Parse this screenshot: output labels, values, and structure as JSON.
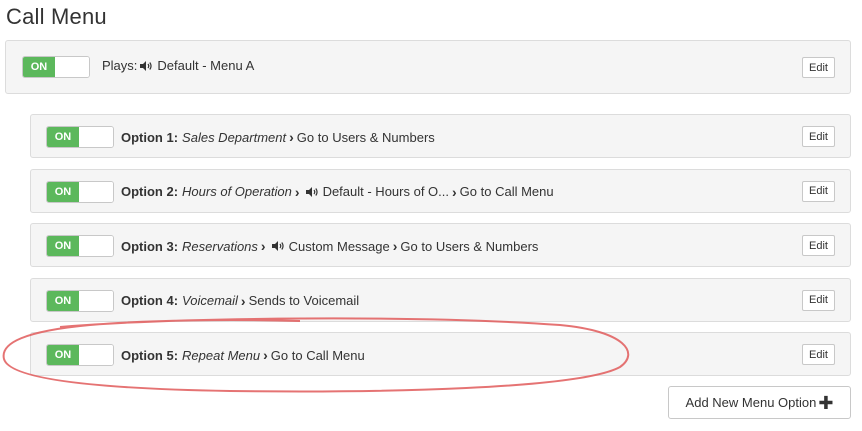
{
  "page": {
    "title": "Call Menu"
  },
  "main_menu": {
    "toggle": "ON",
    "plays_label": "Plays:",
    "plays_value": "Default - Menu A",
    "edit": "Edit"
  },
  "options": [
    {
      "toggle": "ON",
      "label": "Option 1:",
      "name": "Sales Department",
      "steps": [
        {
          "text": "Go to Users & Numbers",
          "speaker": false
        }
      ],
      "edit": "Edit"
    },
    {
      "toggle": "ON",
      "label": "Option 2:",
      "name": "Hours of Operation",
      "steps": [
        {
          "text": "Default - Hours of O...",
          "speaker": true
        },
        {
          "text": "Go to Call Menu",
          "speaker": false
        }
      ],
      "edit": "Edit"
    },
    {
      "toggle": "ON",
      "label": "Option 3:",
      "name": "Reservations",
      "steps": [
        {
          "text": "Custom Message",
          "speaker": true
        },
        {
          "text": "Go to Users & Numbers",
          "speaker": false
        }
      ],
      "edit": "Edit"
    },
    {
      "toggle": "ON",
      "label": "Option 4:",
      "name": "Voicemail",
      "steps": [
        {
          "text": "Sends to Voicemail",
          "speaker": false
        }
      ],
      "edit": "Edit"
    },
    {
      "toggle": "ON",
      "label": "Option 5:",
      "name": "Repeat Menu",
      "steps": [
        {
          "text": "Go to Call Menu",
          "speaker": false
        }
      ],
      "edit": "Edit"
    }
  ],
  "add_button": {
    "label": "Add New Menu Option"
  },
  "colors": {
    "toggle_on": "#5cb85c",
    "panel_bg": "#f5f5f5",
    "annotation": "#e05a5a"
  }
}
